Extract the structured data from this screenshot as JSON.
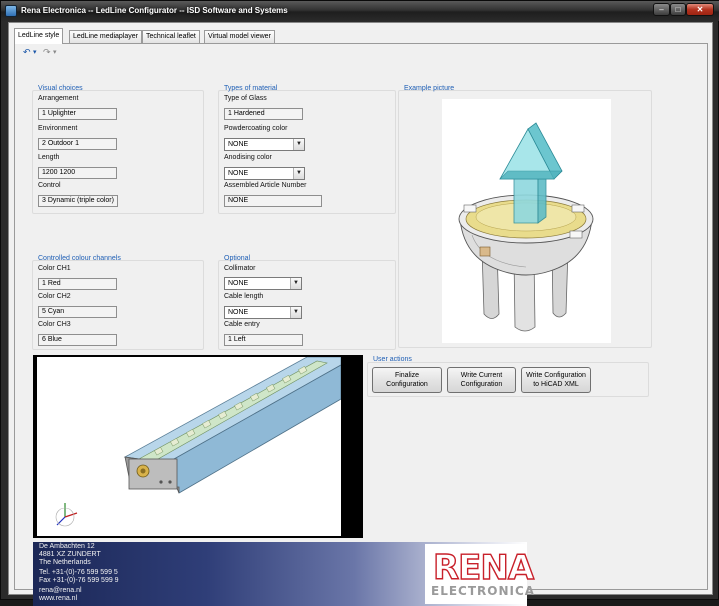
{
  "window": {
    "title": "Rena Electronica -- LedLine Configurator -- ISD Software and Systems",
    "buttons": {
      "minimize": "–",
      "maximize": "□",
      "close": "✕"
    }
  },
  "tabs": [
    {
      "label": "LedLine style",
      "active": true
    },
    {
      "label": "LedLine mediaplayer",
      "active": false
    },
    {
      "label": "Technical leaflet",
      "active": false
    },
    {
      "label": "Virtual model viewer",
      "active": false
    }
  ],
  "quick_access": {
    "undo": "↶",
    "redo": "↷",
    "dropdown": "▾"
  },
  "visual_choices": {
    "title": "Visual choices",
    "arrangement_label": "Arrangement",
    "arrangement_value": "1   Uplighter",
    "environment_label": "Environment",
    "environment_value": "2   Outdoor 1",
    "length_label": "Length",
    "length_value": "1200   1200",
    "control_label": "Control",
    "control_value": "3   Dynamic (triple color)"
  },
  "types_of_material": {
    "title": "Types of material",
    "glass_label": "Type of Glass",
    "glass_value": "1   Hardened",
    "powder_label": "Powdercoating color",
    "powder_value": "NONE",
    "anodising_label": "Anodising color",
    "anodising_value": "NONE",
    "article_label": "Assembled Article Number",
    "article_value": "NONE"
  },
  "example_picture": {
    "title": "Example picture"
  },
  "colour_channels": {
    "title": "Controlled colour channels",
    "ch1_label": "Color CH1",
    "ch1_value": "1   Red",
    "ch2_label": "Color CH2",
    "ch2_value": "5   Cyan",
    "ch3_label": "Color CH3",
    "ch3_value": "6   Blue"
  },
  "optional": {
    "title": "Optional",
    "collimator_label": "Collimator",
    "collimator_value": "NONE",
    "cable_length_label": "Cable length",
    "cable_length_value": "NONE",
    "cable_entry_label": "Cable entry",
    "cable_entry_value": "1   Left"
  },
  "user_actions": {
    "title": "User actions",
    "finalize": "Finalize Configuration",
    "write_current": "Write Current Configuration",
    "write_hicad": "Write Configuration to HiCAD XML"
  },
  "footer": {
    "address": [
      "De Ambachten 12",
      "4881 XZ ZUNDERT",
      "The Netherlands"
    ],
    "tel": "Tel. +31-(0)-76 599 599 5",
    "fax": "Fax +31-(0)-76 599 599 9",
    "email": "rena@rena.nl",
    "web": "www.rena.nl",
    "logo_main": "RENA",
    "logo_sub": "ELECTRONICA"
  },
  "colors": {
    "group_title": "#1f5fb5",
    "close_button": "#b3321f",
    "logo_red": "#c8202a"
  }
}
